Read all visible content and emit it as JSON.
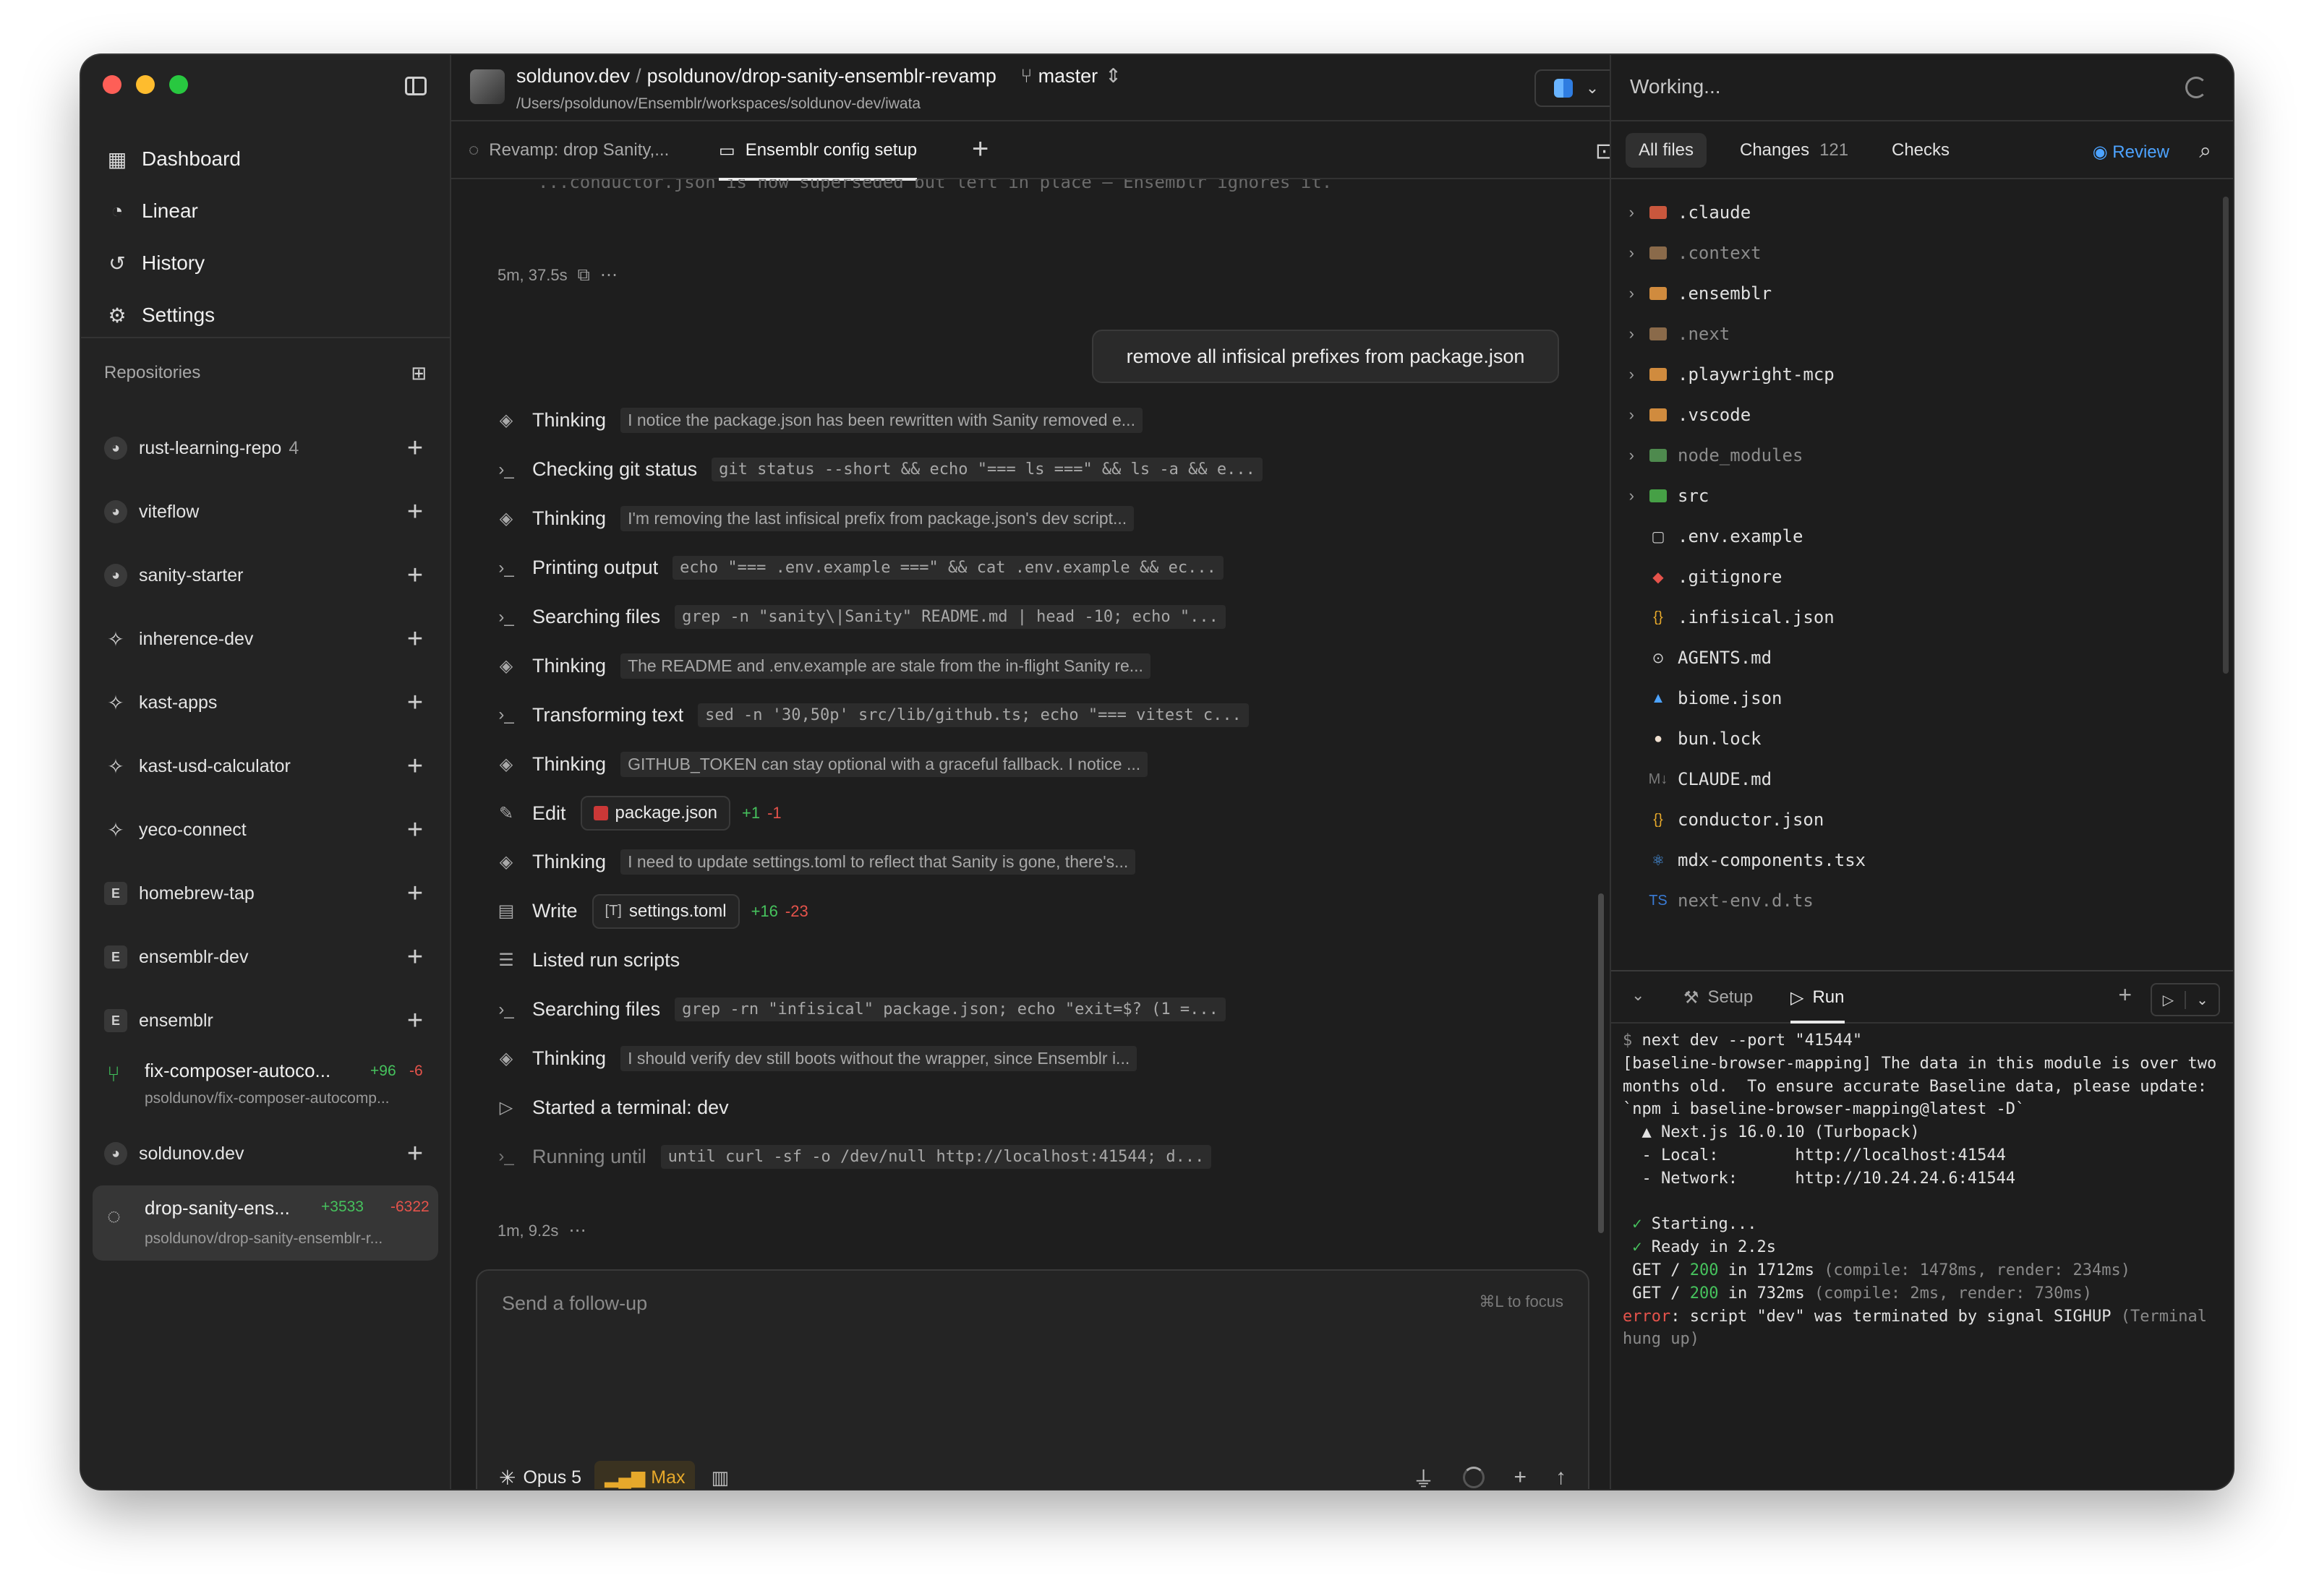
{
  "sidebar": {
    "nav": [
      {
        "label": "Dashboard",
        "icon": "grid-icon"
      },
      {
        "label": "Linear",
        "icon": "linear-icon"
      },
      {
        "label": "History",
        "icon": "history-icon"
      },
      {
        "label": "Settings",
        "icon": "gear-icon"
      }
    ],
    "repos_header": "Repositories",
    "repos": [
      {
        "name": "rust-learning-repo",
        "count": "4",
        "icon": "avatar"
      },
      {
        "name": "viteflow",
        "count": "",
        "icon": "avatar"
      },
      {
        "name": "sanity-starter",
        "count": "",
        "icon": "avatar"
      },
      {
        "name": "inherence-dev",
        "count": "",
        "icon": "diamond"
      },
      {
        "name": "kast-apps",
        "count": "",
        "icon": "diamond"
      },
      {
        "name": "kast-usd-calculator",
        "count": "",
        "icon": "diamond"
      },
      {
        "name": "yeco-connect",
        "count": "",
        "icon": "diamond"
      },
      {
        "name": "homebrew-tap",
        "count": "",
        "icon": "E"
      },
      {
        "name": "ensemblr-dev",
        "count": "",
        "icon": "E"
      },
      {
        "name": "ensemblr",
        "count": "",
        "icon": "E"
      }
    ],
    "branch_fix": {
      "name": "fix-composer-autoco...",
      "sub": "psoldunov/fix-composer-autocomp...",
      "additions": "+96",
      "deletions": "-6"
    },
    "repo_soldunov": {
      "name": "soldunov.dev"
    },
    "branch_active": {
      "name": "drop-sanity-ens...",
      "sub": "psoldunov/drop-sanity-ensemblr-r...",
      "additions": "+3533",
      "deletions": "-6322"
    }
  },
  "header": {
    "org": "soldunov.dev",
    "separator": "/",
    "repo_branch": "psoldunov/drop-sanity-ensemblr-revamp",
    "base_branch": "master",
    "path": "/Users/psoldunov/Ensemblr/workspaces/soldunov-dev/iwata"
  },
  "tabs": [
    {
      "label": "Revamp: drop Sanity,..."
    },
    {
      "label": "Ensemblr config setup"
    }
  ],
  "chat": {
    "ghost_line": "...conductor.json is now superseded but left in place – Ensemblr ignores it.",
    "meta_top": "5m, 37.5s",
    "user_message": "remove all infisical prefixes from package.json",
    "steps": [
      {
        "icon": "thinking-icon",
        "title": "Thinking",
        "detail": "I notice the package.json has been rewritten with Sanity removed e...",
        "mono": false
      },
      {
        "icon": "terminal-icon",
        "title": "Checking git status",
        "detail": "git status --short && echo \"=== ls ===\" && ls -a && e...",
        "mono": true
      },
      {
        "icon": "thinking-icon",
        "title": "Thinking",
        "detail": "I'm removing the last infisical prefix from package.json's dev script...",
        "mono": false
      },
      {
        "icon": "terminal-icon",
        "title": "Printing output",
        "detail": "echo \"=== .env.example ===\" && cat .env.example && ec...",
        "mono": true
      },
      {
        "icon": "terminal-icon",
        "title": "Searching files",
        "detail": "grep -n \"sanity\\|Sanity\" README.md | head -10; echo \"...",
        "mono": true
      },
      {
        "icon": "thinking-icon",
        "title": "Thinking",
        "detail": "The README and .env.example are stale from the in-flight Sanity re...",
        "mono": false
      },
      {
        "icon": "terminal-icon",
        "title": "Transforming text",
        "detail": "sed -n '30,50p' src/lib/github.ts; echo \"=== vitest c...",
        "mono": true
      },
      {
        "icon": "thinking-icon",
        "title": "Thinking",
        "detail": "GITHUB_TOKEN can stay optional with a graceful fallback. I notice ...",
        "mono": false
      }
    ],
    "edit_step": {
      "title": "Edit",
      "file": "package.json",
      "additions": "+1",
      "deletions": "-1"
    },
    "thinking_after_edit": {
      "title": "Thinking",
      "detail": "I need to update settings.toml to reflect that Sanity is gone, there's..."
    },
    "write_step": {
      "title": "Write",
      "file": "settings.toml",
      "file_prefix": "[T]",
      "additions": "+16",
      "deletions": "-23"
    },
    "listed_step": {
      "title": "Listed run scripts"
    },
    "steps2": [
      {
        "icon": "terminal-icon",
        "title": "Searching files",
        "detail": "grep -rn \"infisical\" package.json; echo \"exit=$? (1 =...",
        "mono": true
      },
      {
        "icon": "thinking-icon",
        "title": "Thinking",
        "detail": "I should verify dev still boots without the wrapper, since Ensemblr i...",
        "mono": false
      }
    ],
    "terminal_step": {
      "title": "Started a terminal: dev"
    },
    "running_step": {
      "title": "Running until",
      "detail": "until curl -sf -o /dev/null http://localhost:41544; d..."
    },
    "meta_bottom": "1m, 9.2s"
  },
  "composer": {
    "placeholder": "Send a follow-up",
    "hint": "⌘L to focus",
    "model": "Opus 5",
    "mode": "Max"
  },
  "right": {
    "status": "Working...",
    "tabs": {
      "all_files": "All files",
      "changes": "Changes",
      "changes_count": "121",
      "checks": "Checks"
    },
    "review": "Review",
    "tree": [
      {
        "name": ".claude",
        "type": "folder",
        "color": "#c9573d",
        "expandable": true,
        "dim": false
      },
      {
        "name": ".context",
        "type": "folder",
        "color": "#8a6a4a",
        "expandable": true,
        "dim": true
      },
      {
        "name": ".ensemblr",
        "type": "folder",
        "color": "#d08b3e",
        "expandable": true,
        "dim": false
      },
      {
        "name": ".next",
        "type": "folder",
        "color": "#8a6a4a",
        "expandable": true,
        "dim": true
      },
      {
        "name": ".playwright-mcp",
        "type": "folder",
        "color": "#d08b3e",
        "expandable": true,
        "dim": false
      },
      {
        "name": ".vscode",
        "type": "folder",
        "color": "#d08b3e",
        "expandable": true,
        "dim": false
      },
      {
        "name": "node_modules",
        "type": "folder",
        "color": "#4e8a4e",
        "expandable": true,
        "dim": true
      },
      {
        "name": "src",
        "type": "folder",
        "color": "#46a046",
        "expandable": true,
        "dim": false
      },
      {
        "name": ".env.example",
        "type": "file",
        "icon": "▢",
        "color": "#cfcfcf",
        "dim": false
      },
      {
        "name": ".gitignore",
        "type": "file",
        "icon": "◆",
        "color": "#e5534b",
        "dim": false
      },
      {
        "name": ".infisical.json",
        "type": "file",
        "icon": "{}",
        "color": "#e7a92b",
        "dim": false
      },
      {
        "name": "AGENTS.md",
        "type": "file",
        "icon": "⊙",
        "color": "#cfcfcf",
        "dim": false
      },
      {
        "name": "biome.json",
        "type": "file",
        "icon": "▲",
        "color": "#4da3ff",
        "dim": false
      },
      {
        "name": "bun.lock",
        "type": "file",
        "icon": "●",
        "color": "#f0e0d0",
        "dim": false
      },
      {
        "name": "CLAUDE.md",
        "type": "file",
        "icon": "M↓",
        "color": "#7a7a7a",
        "dim": false
      },
      {
        "name": "conductor.json",
        "type": "file",
        "icon": "{}",
        "color": "#e7a92b",
        "dim": false
      },
      {
        "name": "mdx-components.tsx",
        "type": "file",
        "icon": "⚛",
        "color": "#4da3ff",
        "dim": false
      },
      {
        "name": "next-env.d.ts",
        "type": "file",
        "icon": "TS",
        "color": "#3a7bd5",
        "dim": true
      }
    ],
    "term_tabs": {
      "setup": "Setup",
      "run": "Run"
    },
    "terminal": {
      "prompt": "$ ",
      "cmd": "next dev --port \"41544\"",
      "l1": "[baseline-browser-mapping] The data in this module is over two months old.  To ensure accurate Baseline data, please update: `npm i baseline-browser-mapping@latest -D`",
      "l2": "  ▲ Next.js 16.0.10 (Turbopack)",
      "l3": "  - Local:        http://localhost:41544",
      "l4": "  - Network:      http://10.24.24.6:41544",
      "l5a": " ✓ ",
      "l5b": "Starting...",
      "l6a": " ✓ ",
      "l6b": "Ready in 2.2s",
      "g1a": " GET / ",
      "g1b": "200",
      "g1c": " in 1712ms ",
      "g1d": "(compile: 1478ms, render: 234ms)",
      "g2a": " GET / ",
      "g2b": "200",
      "g2c": " in 732ms ",
      "g2d": "(compile: 2ms, render: 730ms)",
      "e1": "error",
      "e2": ": script \"dev\" was terminated by signal SIGHUP ",
      "e3": "(Terminal hung up)"
    }
  }
}
